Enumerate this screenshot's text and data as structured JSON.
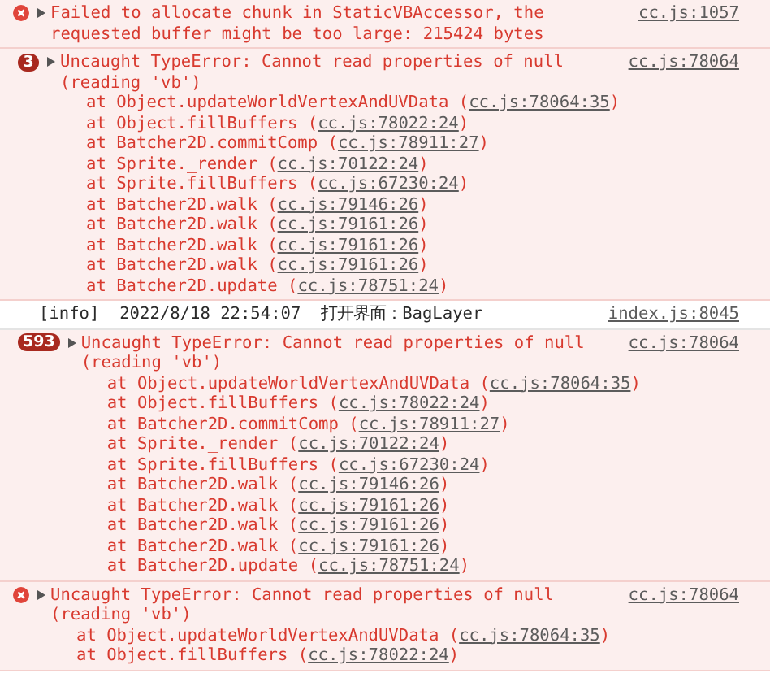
{
  "entries": [
    {
      "kind": "error",
      "message": "Failed to allocate chunk in StaticVBAccessor, the requested buffer might be too large: 215424 bytes",
      "source": "cc.js:1057"
    },
    {
      "kind": "error",
      "count": "3",
      "message": "Uncaught TypeError: Cannot read properties of null (reading 'vb')",
      "source": "cc.js:78064",
      "frames": [
        {
          "call": "at Object.updateWorldVertexAndUVData (",
          "link": "cc.js:78064:35",
          "end": ")"
        },
        {
          "call": "at Object.fillBuffers (",
          "link": "cc.js:78022:24",
          "end": ")"
        },
        {
          "call": "at Batcher2D.commitComp (",
          "link": "cc.js:78911:27",
          "end": ")"
        },
        {
          "call": "at Sprite._render (",
          "link": "cc.js:70122:24",
          "end": ")"
        },
        {
          "call": "at Sprite.fillBuffers (",
          "link": "cc.js:67230:24",
          "end": ")"
        },
        {
          "call": "at Batcher2D.walk (",
          "link": "cc.js:79146:26",
          "end": ")"
        },
        {
          "call": "at Batcher2D.walk (",
          "link": "cc.js:79161:26",
          "end": ")"
        },
        {
          "call": "at Batcher2D.walk (",
          "link": "cc.js:79161:26",
          "end": ")"
        },
        {
          "call": "at Batcher2D.walk (",
          "link": "cc.js:79161:26",
          "end": ")"
        },
        {
          "call": "at Batcher2D.update (",
          "link": "cc.js:78751:24",
          "end": ")"
        }
      ]
    },
    {
      "kind": "info",
      "message": "[info]  2022/8/18 22:54:07  打开界面：BagLayer",
      "source": "index.js:8045"
    },
    {
      "kind": "error",
      "count": "593",
      "message": "Uncaught TypeError: Cannot read properties of null (reading 'vb')",
      "source": "cc.js:78064",
      "frames": [
        {
          "call": "at Object.updateWorldVertexAndUVData (",
          "link": "cc.js:78064:35",
          "end": ")"
        },
        {
          "call": "at Object.fillBuffers (",
          "link": "cc.js:78022:24",
          "end": ")"
        },
        {
          "call": "at Batcher2D.commitComp (",
          "link": "cc.js:78911:27",
          "end": ")"
        },
        {
          "call": "at Sprite._render (",
          "link": "cc.js:70122:24",
          "end": ")"
        },
        {
          "call": "at Sprite.fillBuffers (",
          "link": "cc.js:67230:24",
          "end": ")"
        },
        {
          "call": "at Batcher2D.walk (",
          "link": "cc.js:79146:26",
          "end": ")"
        },
        {
          "call": "at Batcher2D.walk (",
          "link": "cc.js:79161:26",
          "end": ")"
        },
        {
          "call": "at Batcher2D.walk (",
          "link": "cc.js:79161:26",
          "end": ")"
        },
        {
          "call": "at Batcher2D.walk (",
          "link": "cc.js:79161:26",
          "end": ")"
        },
        {
          "call": "at Batcher2D.update (",
          "link": "cc.js:78751:24",
          "end": ")"
        }
      ]
    },
    {
      "kind": "error",
      "message": "Uncaught TypeError: Cannot read properties of null (reading 'vb')",
      "source": "cc.js:78064",
      "frames": [
        {
          "call": "at Object.updateWorldVertexAndUVData (",
          "link": "cc.js:78064:35",
          "end": ")"
        },
        {
          "call": "at Object.fillBuffers (",
          "link": "cc.js:78022:24",
          "end": ")"
        }
      ]
    }
  ]
}
